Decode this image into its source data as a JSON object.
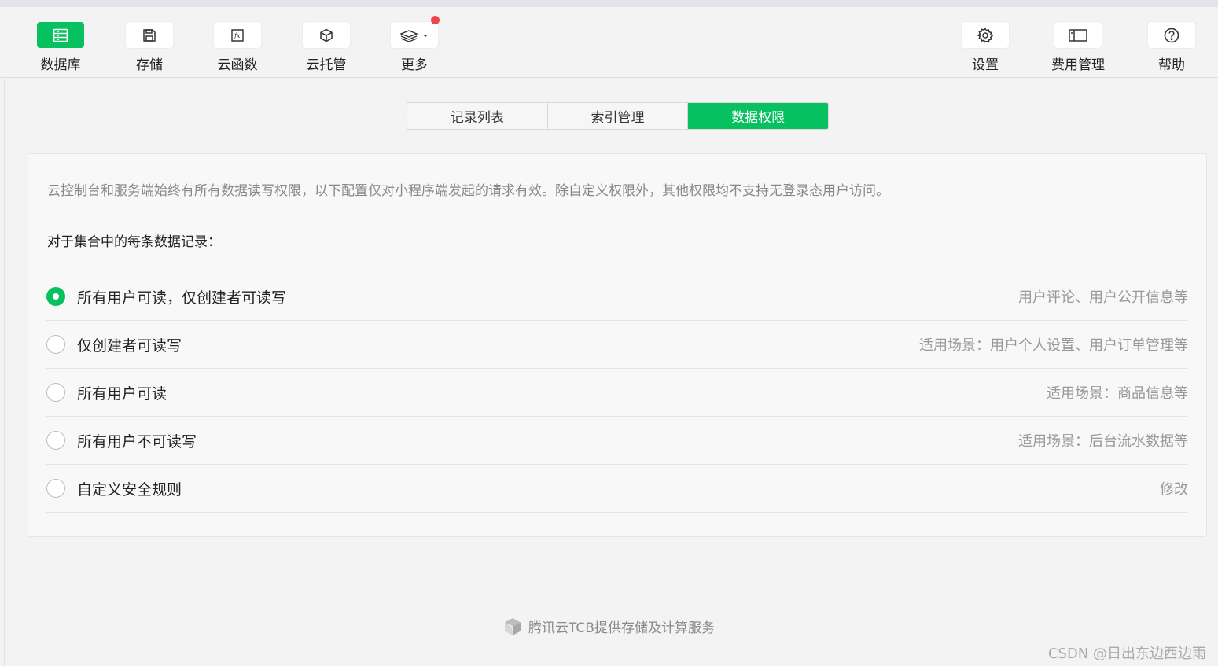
{
  "toolbar": {
    "left": [
      {
        "label": "数据库",
        "icon": "database-icon",
        "active": true
      },
      {
        "label": "存储",
        "icon": "save-icon"
      },
      {
        "label": "云函数",
        "icon": "function-icon"
      },
      {
        "label": "云托管",
        "icon": "cube-icon"
      },
      {
        "label": "更多",
        "icon": "layers-icon",
        "badge": true
      }
    ],
    "right": [
      {
        "label": "设置",
        "icon": "gear-icon"
      },
      {
        "label": "费用管理",
        "icon": "wallet-icon"
      },
      {
        "label": "帮助",
        "icon": "help-icon"
      }
    ]
  },
  "tabs": [
    {
      "label": "记录列表"
    },
    {
      "label": "索引管理"
    },
    {
      "label": "数据权限",
      "active": true
    }
  ],
  "permissions": {
    "notice": "云控制台和服务端始终有所有数据读写权限，以下配置仅对小程序端发起的请求有效。除自定义权限外，其他权限均不支持无登录态用户访问。",
    "intro": "对于集合中的每条数据记录：",
    "options": [
      {
        "label": "所有用户可读，仅创建者可读写",
        "hint": "用户评论、用户公开信息等",
        "checked": true
      },
      {
        "label": "仅创建者可读写",
        "hint": "适用场景：用户个人设置、用户订单管理等"
      },
      {
        "label": "所有用户可读",
        "hint": "适用场景：商品信息等"
      },
      {
        "label": "所有用户不可读写",
        "hint": "适用场景：后台流水数据等"
      },
      {
        "label": "自定义安全规则",
        "hint": "修改"
      }
    ]
  },
  "footer": {
    "text": "腾讯云TCB提供存储及计算服务",
    "icon": "tencent-cloud-icon"
  },
  "watermark": "CSDN @日出东边西边雨",
  "colors": {
    "accent": "#07c160",
    "badge": "#f0454a"
  }
}
